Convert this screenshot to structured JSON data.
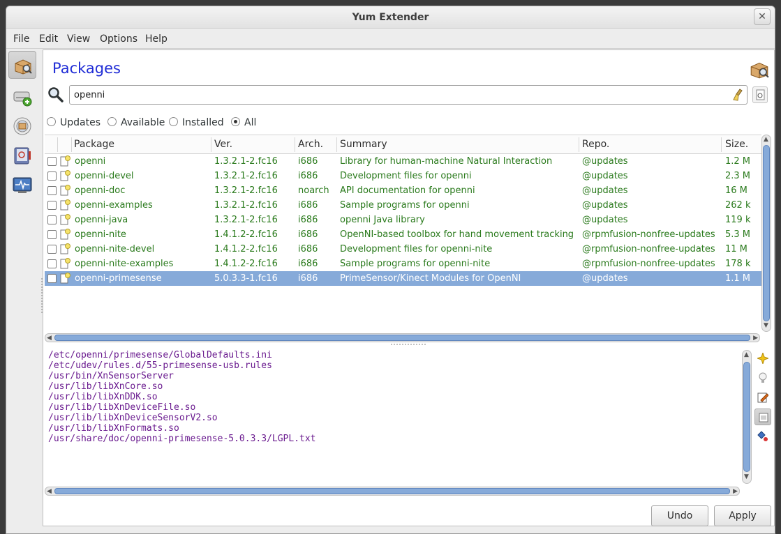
{
  "window": {
    "title": "Yum Extender"
  },
  "menu": [
    "File",
    "Edit",
    "View",
    "Options",
    "Help"
  ],
  "sidebar": [
    {
      "name": "packages-icon",
      "active": true
    },
    {
      "name": "repositories-icon",
      "active": false
    },
    {
      "name": "groups-icon",
      "active": false
    },
    {
      "name": "history-icon",
      "active": false
    },
    {
      "name": "output-icon",
      "active": false
    }
  ],
  "page": {
    "title": "Packages"
  },
  "search": {
    "value": "openni",
    "placeholder": ""
  },
  "filters": {
    "options": [
      "Updates",
      "Available",
      "Installed",
      "All"
    ],
    "selected": "All"
  },
  "table": {
    "columns": [
      "Package",
      "Ver.",
      "Arch.",
      "Summary",
      "Repo.",
      "Size."
    ],
    "rows": [
      {
        "package": "openni",
        "ver": "1.3.2.1-2.fc16",
        "arch": "i686",
        "summary": "Library for human-machine Natural Interaction",
        "repo": "@updates",
        "size": "1.2 M"
      },
      {
        "package": "openni-devel",
        "ver": "1.3.2.1-2.fc16",
        "arch": "i686",
        "summary": "Development files for openni",
        "repo": "@updates",
        "size": "2.3 M"
      },
      {
        "package": "openni-doc",
        "ver": "1.3.2.1-2.fc16",
        "arch": "noarch",
        "summary": "API documentation for openni",
        "repo": "@updates",
        "size": "16 M"
      },
      {
        "package": "openni-examples",
        "ver": "1.3.2.1-2.fc16",
        "arch": "i686",
        "summary": "Sample programs for openni",
        "repo": "@updates",
        "size": "262 k"
      },
      {
        "package": "openni-java",
        "ver": "1.3.2.1-2.fc16",
        "arch": "i686",
        "summary": "openni Java library",
        "repo": "@updates",
        "size": "119 k"
      },
      {
        "package": "openni-nite",
        "ver": "1.4.1.2-2.fc16",
        "arch": "i686",
        "summary": "OpenNI-based toolbox for hand movement tracking",
        "repo": "@rpmfusion-nonfree-updates",
        "size": "5.3 M"
      },
      {
        "package": "openni-nite-devel",
        "ver": "1.4.1.2-2.fc16",
        "arch": "i686",
        "summary": "Development files for openni-nite",
        "repo": "@rpmfusion-nonfree-updates",
        "size": "11 M"
      },
      {
        "package": "openni-nite-examples",
        "ver": "1.4.1.2-2.fc16",
        "arch": "i686",
        "summary": "Sample programs for openni-nite",
        "repo": "@rpmfusion-nonfree-updates",
        "size": "178 k"
      },
      {
        "package": "openni-primesense",
        "ver": "5.0.3.3-1.fc16",
        "arch": "i686",
        "summary": "PrimeSensor/Kinect Modules for OpenNI",
        "repo": "@updates",
        "size": "1.1 M",
        "selected": true
      }
    ]
  },
  "files": [
    "/etc/openni/primesense/GlobalDefaults.ini",
    "/etc/udev/rules.d/55-primesense-usb.rules",
    "/usr/bin/XnSensorServer",
    "/usr/lib/libXnCore.so",
    "/usr/lib/libXnDDK.so",
    "/usr/lib/libXnDeviceFile.so",
    "/usr/lib/libXnDeviceSensorV2.so",
    "/usr/lib/libXnFormats.so",
    "/usr/share/doc/openni-primesense-5.0.3.3/LGPL.txt"
  ],
  "info_tools": [
    "description-icon",
    "updateinfo-icon",
    "changelog-icon",
    "filelist-icon",
    "dependencies-icon"
  ],
  "buttons": {
    "undo": "Undo",
    "apply": "Apply"
  },
  "colors": {
    "accent": "#1f2cd6",
    "selection": "#86aad9",
    "package_text": "#2a7a1c",
    "file_text": "#6a1b8f"
  }
}
